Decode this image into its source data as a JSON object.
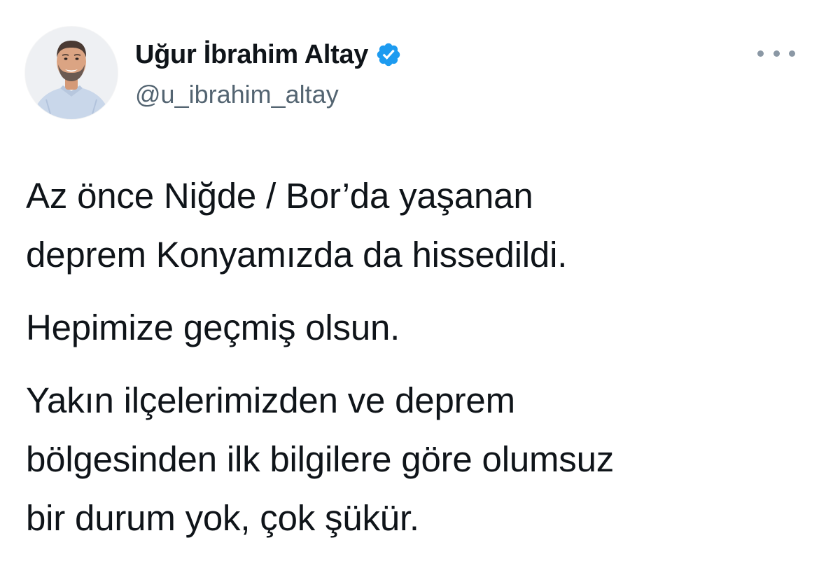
{
  "author": {
    "display_name": "Uğur İbrahim Altay",
    "handle": "@u_ibrahim_altay",
    "verified": true,
    "avatar_icon": "profile-photo",
    "verified_icon": "verified-badge-icon",
    "verified_color": "#1d9bf0"
  },
  "menu": {
    "icon": "more-options-icon"
  },
  "tweet": {
    "paragraphs": [
      [
        "Az önce Niğde / Bor’da yaşanan",
        "deprem Konyamızda da hissedildi."
      ],
      [
        "Hepimize geçmiş olsun."
      ],
      [
        "Yakın ilçelerimizden ve deprem",
        "bölgesinden ilk bilgilere göre olumsuz",
        "bir durum yok, çok şükür."
      ]
    ]
  },
  "colors": {
    "text": "#0f1419",
    "secondary_text": "#536471",
    "background": "#ffffff"
  }
}
